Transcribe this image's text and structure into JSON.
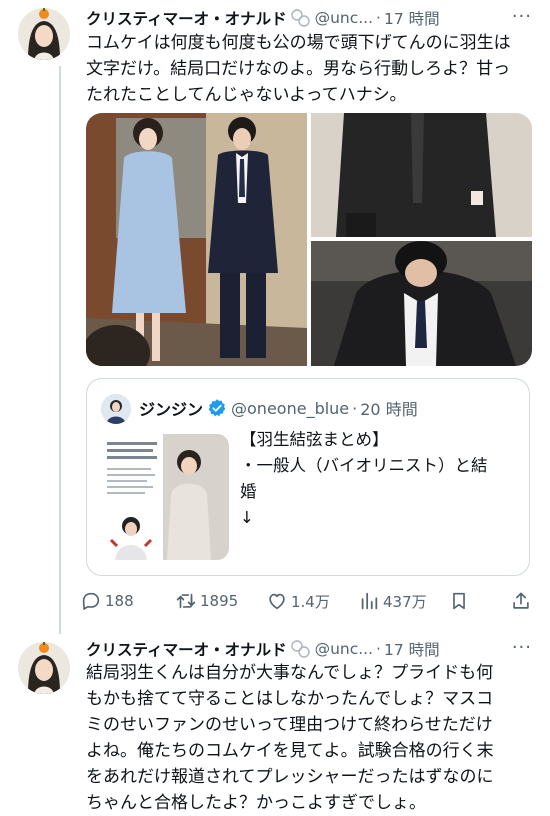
{
  "tweet1": {
    "name": "クリスティマーオ・オナルド",
    "handle": "@unc...",
    "dot": "·",
    "time": "17 時間",
    "more": "···",
    "lines": [
      "コムケイは何度も何度も公の場で頭下げてんのに羽生は",
      "文字だけ。結局口だけなのよ。男なら行動しろよ？甘っ",
      "たれたことしてんじゃないよってハナシ。"
    ]
  },
  "quote": {
    "name": "ジンジン",
    "handle": "@oneone_blue",
    "dot": "·",
    "time": "20 時間",
    "lines": [
      "【羽生結弦まとめ】",
      "・一般人（バイオリニスト）と結",
      "婚",
      "↓"
    ]
  },
  "actions": {
    "replies": "188",
    "retweets": "1895",
    "likes": "1.4万",
    "views": "437万"
  },
  "tweet2": {
    "name": "クリスティマーオ・オナルド",
    "handle": "@unc...",
    "dot": "·",
    "time": "17 時間",
    "more": "···",
    "lines": [
      "結局羽生くんは自分が大事なんでしょ？プライドも何",
      "もかも捨てて守ることはしなかったんでしょ？マスコ",
      "ミのせいファンのせいって理由つけて終わらせただけ",
      "よね。俺たちのコムケイを見てよ。試験合格の行く末",
      "をあれだけ報道されてプレッシャーだったはずなのに",
      "ちゃんと合格したよ？かっこよすぎでしょ。"
    ]
  },
  "colors": {
    "text": "#0f1419",
    "secondary": "#536471",
    "border": "#cfd9de",
    "verified": "#1d9bf0"
  }
}
